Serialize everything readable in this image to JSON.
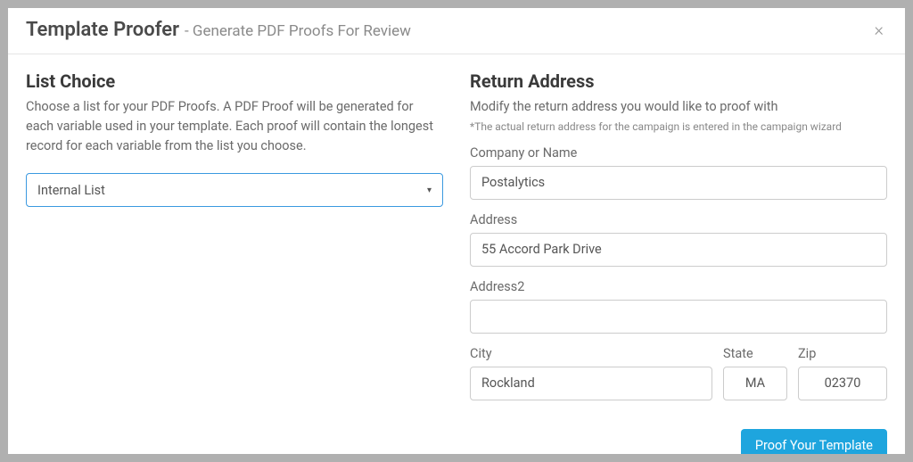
{
  "header": {
    "title": "Template Proofer",
    "subtitle": "- Generate PDF Proofs For Review",
    "close_glyph": "×"
  },
  "list_choice": {
    "title": "List Choice",
    "description": "Choose a list for your PDF Proofs. A PDF Proof will be generated for each variable used in your template. Each proof will contain the longest record for each variable from the list you choose.",
    "selected": "Internal List",
    "caret": "▾"
  },
  "return_address": {
    "title": "Return Address",
    "description": "Modify the return address you would like to proof with",
    "note": "*The actual return address for the campaign is entered in the campaign wizard",
    "labels": {
      "company": "Company or Name",
      "address": "Address",
      "address2": "Address2",
      "city": "City",
      "state": "State",
      "zip": "Zip"
    },
    "values": {
      "company": "Postalytics",
      "address": "55 Accord Park Drive",
      "address2": "",
      "city": "Rockland",
      "state": "MA",
      "zip": "02370"
    }
  },
  "actions": {
    "proof_label": "Proof Your Template"
  }
}
